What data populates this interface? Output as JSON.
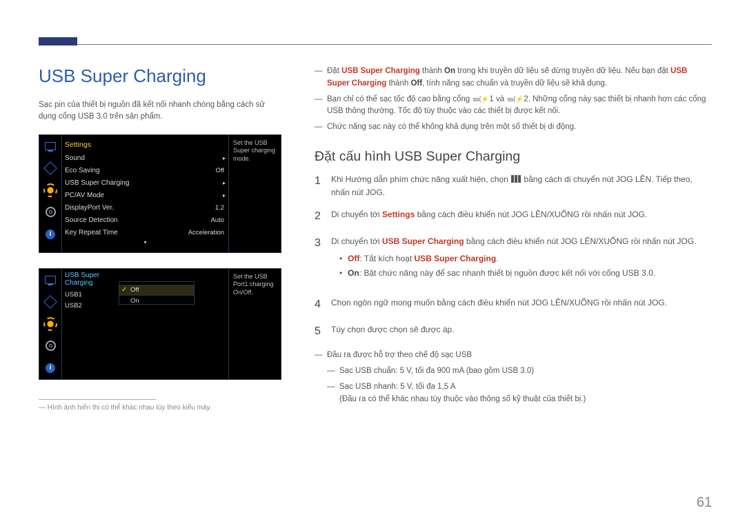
{
  "page": {
    "number": "61",
    "footnote": "Hình ảnh hiển thị có thể khác nhau tùy theo kiểu máy."
  },
  "left": {
    "title": "USB Super Charging",
    "intro": "Sạc pin của thiết bị nguồn đã kết nối nhanh chóng bằng cách sử dụng cổng USB 3.0 trên sản phẩm."
  },
  "osd1": {
    "header": "Settings",
    "help": "Set the USB Super charging mode.",
    "rows": [
      {
        "label": "Sound",
        "value": "",
        "chev": "▸"
      },
      {
        "label": "Eco Saving",
        "value": "Off",
        "chev": ""
      },
      {
        "label": "USB Super Charging",
        "value": "",
        "chev": "▸"
      },
      {
        "label": "PC/AV Mode",
        "value": "",
        "chev": "▸"
      },
      {
        "label": "DisplayPort Ver.",
        "value": "1.2",
        "chev": ""
      },
      {
        "label": "Source Detection",
        "value": "Auto",
        "chev": ""
      },
      {
        "label": "Key Repeat Time",
        "value": "Acceleration",
        "chev": ""
      }
    ],
    "scroll": "▾"
  },
  "osd2": {
    "header": "USB Super Charging",
    "help": "Set the USB Port1 charging On/Off.",
    "items": [
      "USB1",
      "USB2"
    ],
    "options": [
      "Off",
      "On"
    ],
    "selected_index": 0
  },
  "nav_icons": [
    "monitor-icon",
    "diamond-icon",
    "sun-icon",
    "gear-icon",
    "info-icon"
  ],
  "right": {
    "notes": {
      "n1_pre": "Đặt ",
      "n1_kw1": "USB Super Charging",
      "n1_mid1": " thành ",
      "n1_on": "On",
      "n1_mid2": " trong khi truyền dữ liệu sẽ dừng truyền dữ liệu. Nếu bạn đặt ",
      "n1_kw2": "USB Super Charging",
      "n1_mid3": " thành ",
      "n1_off": "Off",
      "n1_post": ", tính năng sạc chuẩn và truyền dữ liệu sẽ khả dụng.",
      "n2_a": "Bạn chỉ có thể sạc tốc độ cao bằng cổng ",
      "n2_p1": "1",
      "n2_and": " và ",
      "n2_p2": "2",
      "n2_b": ". Những cổng này sạc thiết bị nhanh hơn các cổng USB thông thường. Tốc độ tùy thuộc vào các thiết bị được kết nối.",
      "n3": "Chức năng sạc này có thể không khả dụng trên một số thiết bị di động."
    },
    "subtitle": "Đặt cấu hình USB Super Charging",
    "steps": {
      "s1_a": "Khi Hướng dẫn phím chức năng xuất hiện, chọn ",
      "s1_b": " bằng cách di chuyển nút JOG LÊN. Tiếp theo, nhấn nút JOG.",
      "s2_a": "Di chuyển tới ",
      "s2_kw": "Settings",
      "s2_b": " bằng cách điều khiển nút JOG LÊN/XUỐNG rồi nhấn nút JOG.",
      "s3_a": "Di chuyển tới ",
      "s3_kw": "USB Super Charging",
      "s3_b": " bằng cách điều khiển nút JOG LÊN/XUỐNG rồi nhấn nút JOG.",
      "bullet_off_kw": "Off",
      "bullet_off_txt": ": Tắt kích hoạt ",
      "bullet_off_kw2": "USB Super Charging",
      "bullet_off_end": ".",
      "bullet_on_kw": "On",
      "bullet_on_txt": ": Bật chức năng này để sạc nhanh thiết bị nguồn được kết nối với cổng USB 3.0.",
      "s4": "Chọn ngôn ngữ mong muốn bằng cách điều khiển nút JOG LÊN/XUỐNG rồi nhấn nút JOG.",
      "s5": "Tùy chọn được chọn sẽ được áp."
    },
    "outputs": {
      "lead": "Đầu ra được hỗ trợ theo chế độ sạc USB",
      "l1": "Sạc USB chuẩn: 5 V, tối đa 900 mA (bao gồm USB 3.0)",
      "l2": "Sạc USB nhanh: 5 V, tối đa 1,5 A",
      "l2_note": "(Đầu ra có thể khác nhau tùy thuộc vào thông số kỹ thuật của thiết bị.)"
    }
  }
}
